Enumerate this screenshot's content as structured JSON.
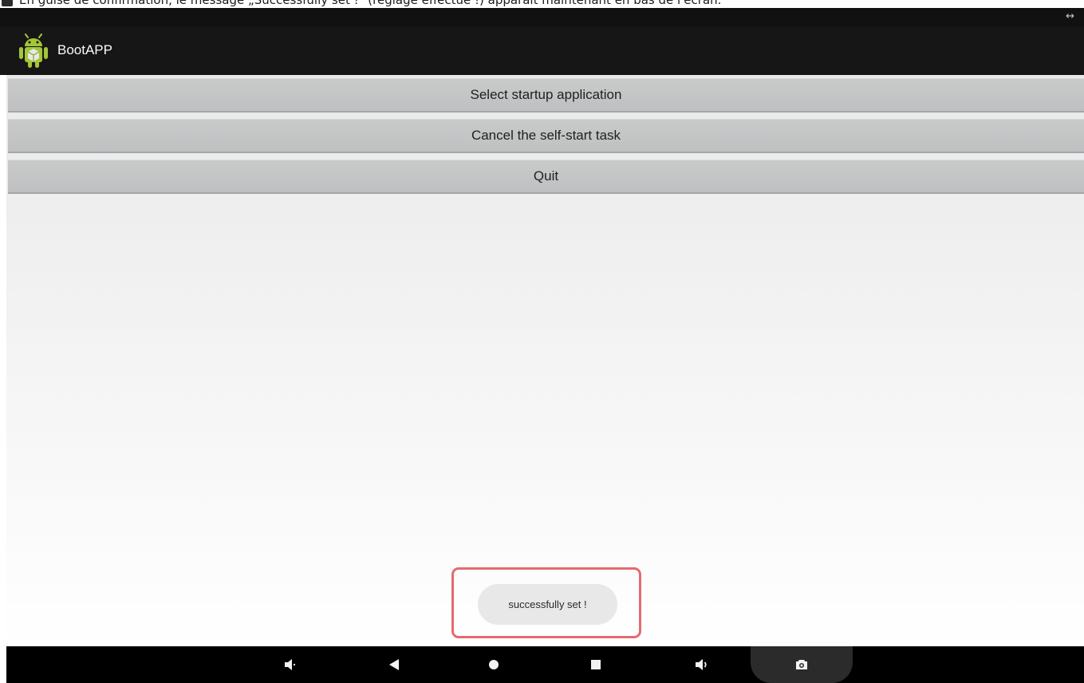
{
  "caption": {
    "text": "En guise de confirmation, le message „Successfully set !\" (réglage effectué !) apparaît maintenant en bas de l'écran."
  },
  "status_bar": {
    "icon": "resize-arrows-icon",
    "glyph": "↔"
  },
  "action_bar": {
    "app_title": "BootAPP",
    "app_icon": "android-robot-icon"
  },
  "buttons": [
    {
      "label": "Select startup application"
    },
    {
      "label": "Cancel the self-start task"
    },
    {
      "label": "Quit"
    }
  ],
  "toast": {
    "message": "successfully set !",
    "highlight_color": "#e36b6f"
  },
  "nav_bar": {
    "items": [
      {
        "icon": "volume-down-icon"
      },
      {
        "icon": "back-icon"
      },
      {
        "icon": "home-icon"
      },
      {
        "icon": "recents-icon"
      },
      {
        "icon": "volume-up-icon"
      },
      {
        "icon": "screenshot-icon"
      }
    ]
  },
  "colors": {
    "action_bar_bg": "#161616",
    "button_bg": "#c4c5c5",
    "nav_bar_bg": "#000000",
    "android_green": "#a4c639"
  }
}
